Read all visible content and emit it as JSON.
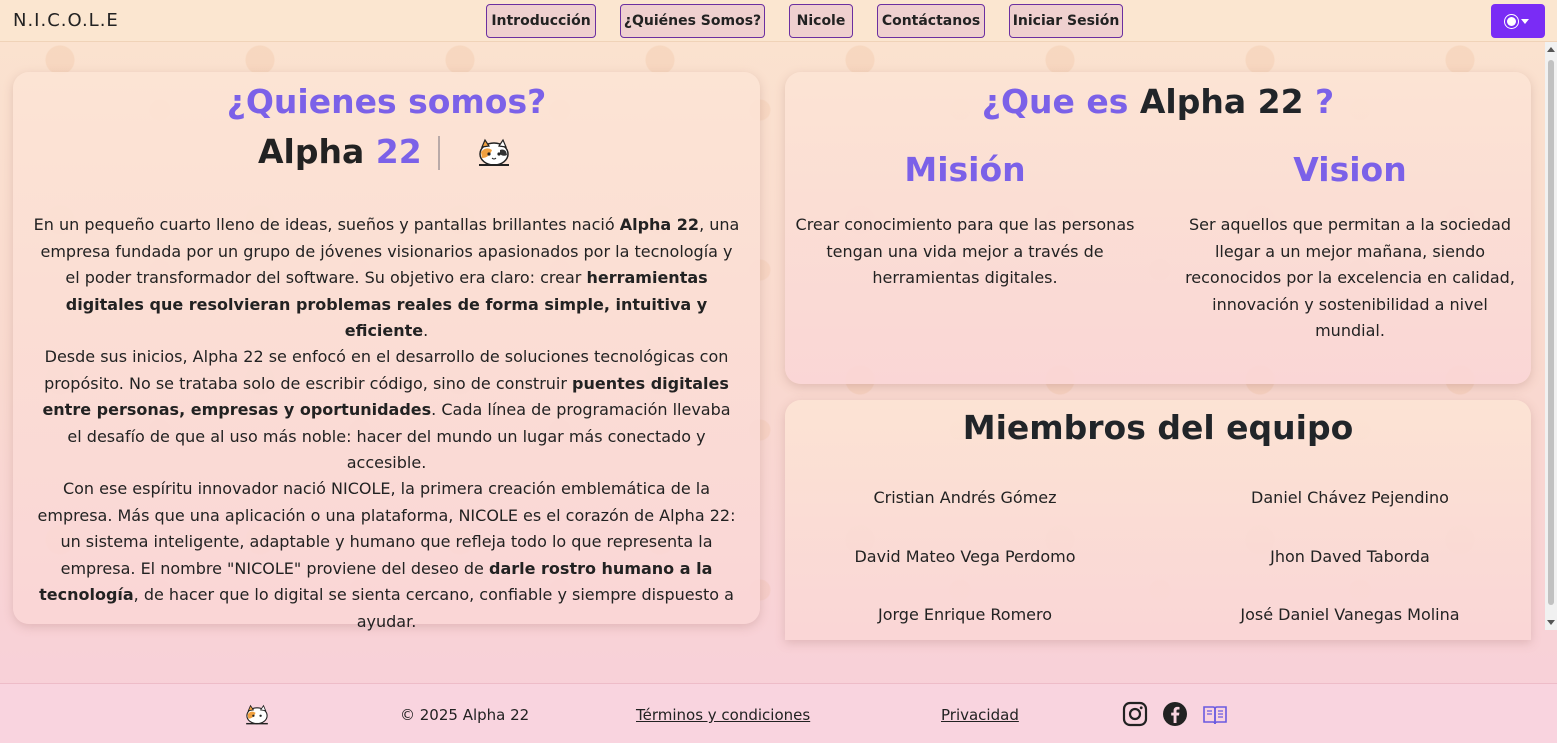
{
  "navbar": {
    "brand": "N.I.C.O.L.E",
    "items": [
      {
        "label": "Introducción"
      },
      {
        "label": "¿Quiénes Somos?"
      },
      {
        "label": "Nicole"
      },
      {
        "label": "Contáctanos"
      },
      {
        "label": "Iniciar Sesión"
      }
    ],
    "theme_toggle_icon": "sun-icon"
  },
  "about": {
    "title": "¿Quienes somos?",
    "alpha_word": "Alpha",
    "alpha_number": "22",
    "logo_icon": "nicole-cat-logo-icon",
    "paragraphs": [
      {
        "p1": "En un pequeño cuarto lleno de ideas, sueños y pantallas brillantes nació ",
        "b1": "Alpha 22",
        "p2": ", una empresa fundada por un grupo de jóvenes visionarios apasionados por la tecnología y el poder transformador del software. Su objetivo era claro: crear ",
        "b2": "herramientas digitales que resolvieran problemas reales de forma simple, intuitiva y eficiente",
        "p3": "."
      },
      {
        "p1": "Desde sus inicios, Alpha 22 se enfocó en el desarrollo de soluciones tecnológicas con propósito. No se trataba solo de escribir código, sino de construir ",
        "b1": "puentes digitales entre personas, empresas y oportunidades",
        "p2": ". Cada línea de programación llevaba el desafío de que al uso más noble: hacer del mundo un lugar más conectado y accesible."
      },
      {
        "p1": "Con ese espíritu innovador nació NICOLE, la primera creación emblemática de la empresa. Más que una aplicación o una plataforma, NICOLE es el corazón de Alpha 22: un sistema inteligente, adaptable y humano que refleja todo lo que representa la empresa. El nombre \"NICOLE\" proviene del deseo de ",
        "b1": "darle rostro humano a la tecnología",
        "p2": ", de hacer que lo digital se sienta cercano, confiable y siempre dispuesto a ayudar."
      }
    ]
  },
  "what_is": {
    "title_part1": "¿Que es",
    "title_part2": "Alpha 22",
    "title_part3": "?",
    "mission_title": "Misión",
    "mission_text": "Crear conocimiento para que las personas tengan una vida mejor a través de herramientas digitales.",
    "vision_title": "Vision",
    "vision_text": "Ser aquellos que permitan a la sociedad llegar a un mejor mañana, siendo reconocidos por la excelencia en calidad, innovación y sostenibilidad a nivel mundial."
  },
  "team": {
    "title": "Miembros del equipo",
    "members": [
      "Cristian Andrés Gómez",
      "Daniel Chávez Pejendino",
      "David Mateo Vega Perdomo",
      "Jhon Daved Taborda",
      "Jorge Enrique Romero",
      "José Daniel Vanegas Molina"
    ]
  },
  "footer": {
    "logo_icon": "nicole-cat-logo-icon",
    "copyright": "© 2025 Alpha 22",
    "terms": "Términos y condiciones",
    "privacy": "Privacidad",
    "social_icons": [
      "instagram-icon",
      "facebook-icon",
      "book-icon"
    ]
  },
  "colors": {
    "accent_purple": "#7b61e8",
    "theme_button": "#7a2cf5",
    "nav_border": "#6b2fa0"
  }
}
